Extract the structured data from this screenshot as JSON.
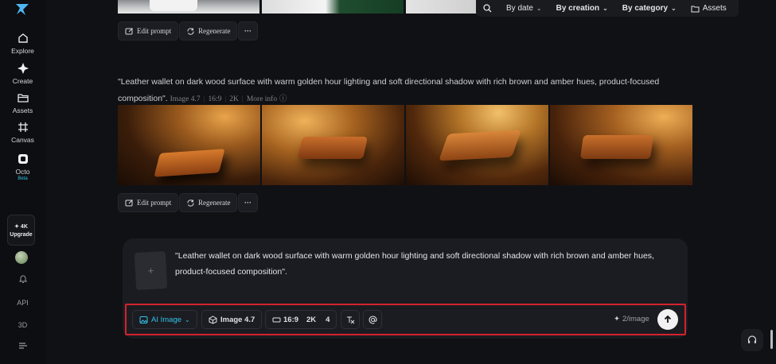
{
  "sidebar": {
    "items": [
      {
        "label": "Explore",
        "icon": "home-icon"
      },
      {
        "label": "Create",
        "icon": "sparkle-icon"
      },
      {
        "label": "Assets",
        "icon": "folder-icon"
      },
      {
        "label": "Canvas",
        "icon": "canvas-icon"
      },
      {
        "label": "Octo",
        "icon": "octo-icon",
        "badge": "Beta"
      }
    ],
    "upgrade": {
      "top": "✦ 4K",
      "bottom": "Upgrade"
    },
    "bottom": {
      "api": "API",
      "three_d": "3D"
    }
  },
  "filters": {
    "date": "By date",
    "creation": "By creation",
    "category": "By category",
    "assets": "Assets"
  },
  "actions": {
    "edit": "Edit prompt",
    "regenerate": "Regenerate",
    "more": "···"
  },
  "generation": {
    "prompt": "\"Leather wallet on dark wood surface with warm golden hour lighting and soft directional shadow with rich brown and amber hues, product-focused composition\".",
    "model": "Image 4.7",
    "ratio": "16:9",
    "resolution": "2K",
    "more_info": "More info"
  },
  "composer": {
    "text": "\"Leather wallet on dark wood surface with warm golden hour lighting and soft directional shadow with rich brown and amber hues, product-focused composition\".",
    "upload_icon": "+",
    "mode": "AI Image",
    "model": "Image 4.7",
    "ratio": "16:9",
    "resolution": "2K",
    "count": "4",
    "credits": "2/image"
  },
  "colors": {
    "accent": "#33c2e8",
    "highlight": "#d3222e",
    "background": "#101114"
  }
}
